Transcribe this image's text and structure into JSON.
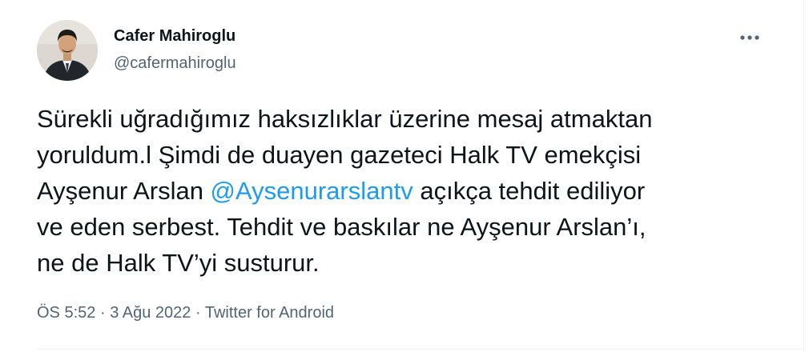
{
  "author": {
    "display_name": "Cafer Mahiroglu",
    "handle": "@cafermahiroglu"
  },
  "more_icon": "more-horizontal-icon",
  "tweet": {
    "lines": [
      {
        "before": "Sürekli uğradığımız haksızlıklar üzerine mesaj atmaktan"
      },
      {
        "before": "yoruldum.l Şimdi de duayen gazeteci Halk TV  emekçisi"
      },
      {
        "before": "Ayşenur Arslan ",
        "mention": "@Aysenurarslantv",
        "after": " açıkça tehdit ediliyor"
      },
      {
        "before": "ve eden serbest. Tehdit ve baskılar ne Ayşenur Arslan’ı,"
      },
      {
        "before": "ne de Halk TV’yi susturur."
      }
    ]
  },
  "meta": {
    "time": "ÖS 5:52",
    "separator": "·",
    "date": "3 Ağu 2022",
    "source": "Twitter for Android"
  },
  "colors": {
    "text": "#0f1419",
    "secondary": "#536471",
    "accent": "#1d9bf0"
  }
}
